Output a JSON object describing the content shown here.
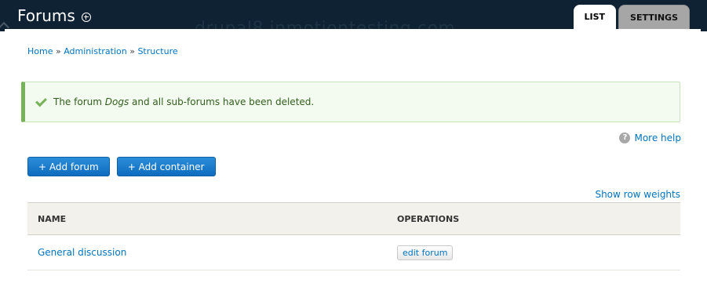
{
  "header": {
    "title": "Forums",
    "watermark": "drupal8.inmotiontesting.com",
    "tabs": [
      {
        "label": "LIST",
        "active": true
      },
      {
        "label": "SETTINGS",
        "active": false
      }
    ]
  },
  "breadcrumb": {
    "items": [
      "Home",
      "Administration",
      "Structure"
    ],
    "separator": "»"
  },
  "status_message": {
    "prefix": "The forum ",
    "forum_name": "Dogs",
    "suffix": " and all sub-forums have been deleted.",
    "icon": "check-icon"
  },
  "help": {
    "label": "More help",
    "icon": "question-icon"
  },
  "actions": {
    "add_forum": "+ Add forum",
    "add_container": "+ Add container"
  },
  "show_row_weights": "Show row weights",
  "table": {
    "columns": [
      "NAME",
      "OPERATIONS"
    ],
    "rows": [
      {
        "name": "General discussion",
        "operation": "edit forum"
      }
    ]
  },
  "colors": {
    "header_bg": "#0f2233",
    "link": "#0074bd",
    "success_border": "#77b259",
    "button_blue": "#0f6cbf"
  }
}
